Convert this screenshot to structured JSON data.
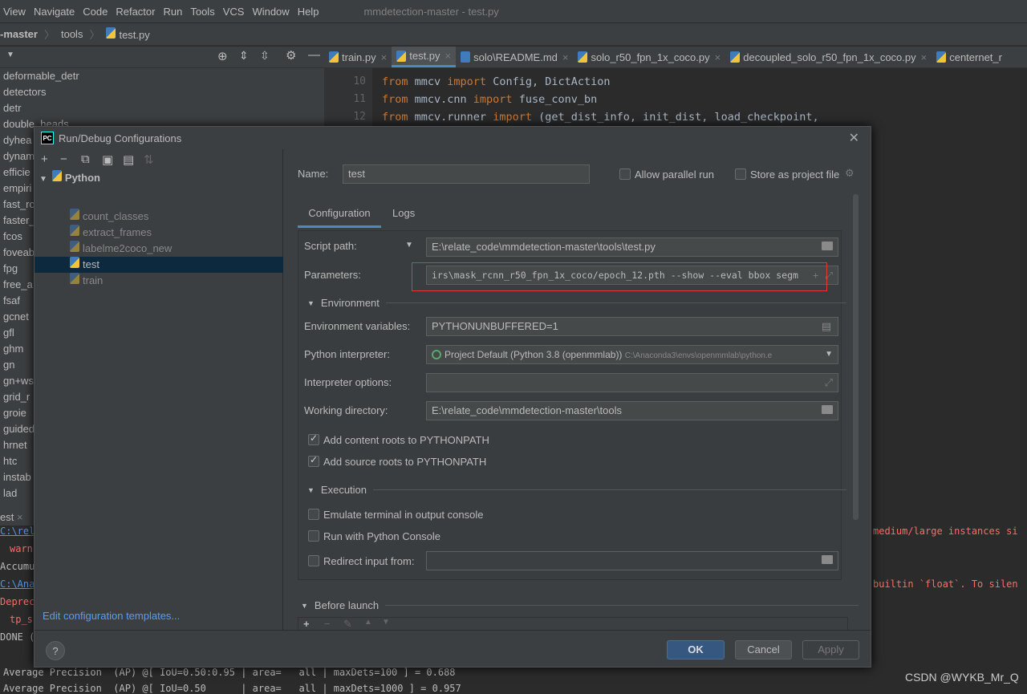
{
  "menu": [
    "View",
    "Navigate",
    "Code",
    "Refactor",
    "Run",
    "Tools",
    "VCS",
    "Window",
    "Help"
  ],
  "window_title": "mmdetection-master - test.py",
  "breadcrumb": [
    "-master",
    "tools",
    "test.py"
  ],
  "tree": [
    "deformable_detr",
    "detectors",
    "detr",
    "double_heads",
    "dyhea",
    "dynam",
    "efficie",
    "empiri",
    "fast_rc",
    "faster_",
    "fcos",
    "foveab",
    "fpg",
    "free_a",
    "fsaf",
    "gcnet",
    "gfl",
    "ghm",
    "gn",
    "gn+ws",
    "grid_r",
    "groie",
    "guided",
    "hrnet",
    "htc",
    "instab",
    "lad"
  ],
  "tabs": [
    {
      "label": "train.py",
      "icon": "python-file-icon"
    },
    {
      "label": "test.py",
      "icon": "python-file-icon",
      "active": true
    },
    {
      "label": "solo\\README.md",
      "icon": "markdown-file-icon"
    },
    {
      "label": "solo_r50_fpn_1x_coco.py",
      "icon": "python-file-icon"
    },
    {
      "label": "decoupled_solo_r50_fpn_1x_coco.py",
      "icon": "python-file-icon"
    },
    {
      "label": "centernet_r",
      "icon": "python-file-icon"
    }
  ],
  "code": [
    {
      "ln": "10",
      "kw1": "from",
      "mod": " mmcv ",
      "kw2": "import",
      "rest": " Config, DictAction"
    },
    {
      "ln": "11",
      "kw1": "from",
      "mod": " mmcv.cnn ",
      "kw2": "import",
      "rest": " fuse_conv_bn"
    },
    {
      "ln": "12",
      "kw1": "from",
      "mod": " mmcv.runner ",
      "kw2": "import",
      "rest": " (get_dist_info, init_dist, load_checkpoint,"
    }
  ],
  "console": {
    "tab": "est",
    "left": [
      "C:\\rel",
      "warn",
      "Accumu",
      "C:\\Ana",
      "Deprec",
      "tp_s",
      "DONE ("
    ],
    "right": [
      "medium/large instances si",
      "builtin `float`. To silen"
    ],
    "bottom": [
      "Average Precision  (AP) @[ IoU=0.50:0.95 | area=   all | maxDets=100 ] = 0.688",
      "Average Precision  (AP) @[ IoU=0.50      | area=   all | maxDets=1000 ] = 0.957"
    ]
  },
  "dialog": {
    "title": "Run/Debug Configurations",
    "group": "Python",
    "configs": [
      "count_classes",
      "extract_frames",
      "labelme2coco_new",
      "test",
      "train"
    ],
    "selected": "test",
    "edit_templates": "Edit configuration templates...",
    "name_label": "Name:",
    "name_value": "test",
    "allow_parallel": "Allow parallel run",
    "store_project": "Store as project file",
    "tab_config": "Configuration",
    "tab_logs": "Logs",
    "script_label": "Script path:",
    "script_value": "E:\\relate_code\\mmdetection-master\\tools\\test.py",
    "params_label": "Parameters:",
    "params_value": "irs\\mask_rcnn_r50_fpn_1x_coco/epoch_12.pth --show --eval bbox segm",
    "env_section": "Environment",
    "envvars_label": "Environment variables:",
    "envvars_value": "PYTHONUNBUFFERED=1",
    "interp_label": "Python interpreter:",
    "interp_value": "Project Default (Python 3.8 (openmmlab))",
    "interp_path": "C:\\Anaconda3\\envs\\openmmlab\\python.e",
    "interp_opts_label": "Interpreter options:",
    "interp_opts_value": "",
    "workdir_label": "Working directory:",
    "workdir_value": "E:\\relate_code\\mmdetection-master\\tools",
    "content_roots": "Add content roots to PYTHONPATH",
    "source_roots": "Add source roots to PYTHONPATH",
    "exec_section": "Execution",
    "emulate": "Emulate terminal in output console",
    "python_console": "Run with Python Console",
    "redirect": "Redirect input from:",
    "redirect_value": "",
    "before_launch": "Before launch",
    "ok": "OK",
    "cancel": "Cancel",
    "apply": "Apply",
    "help": "?"
  },
  "watermark": "CSDN @WYKB_Mr_Q",
  "highlight_color": "#e53935",
  "accent": "#4a88c7"
}
